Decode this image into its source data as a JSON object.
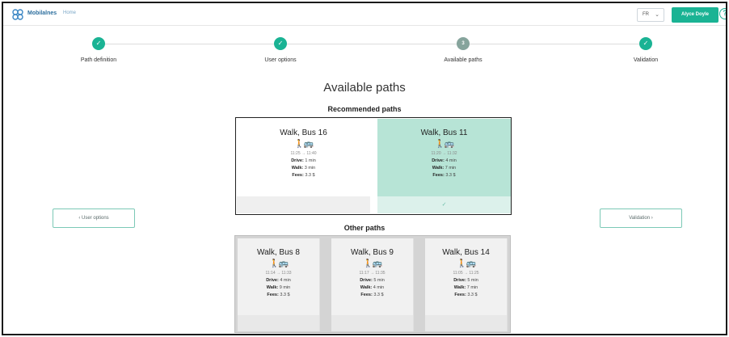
{
  "header": {
    "brand": "Mobilalnes",
    "brand_sub": "Home",
    "language": "FR",
    "user_name": "Alyce Doyle",
    "help": "?"
  },
  "stepper": {
    "steps": [
      {
        "label": "Path definition",
        "marker": "✓"
      },
      {
        "label": "User options",
        "marker": "✓"
      },
      {
        "label": "Available paths",
        "marker": "3"
      },
      {
        "label": "Validation",
        "marker": "✓"
      }
    ]
  },
  "page_title": "Available paths",
  "recommended": {
    "title": "Recommended paths",
    "cards": [
      {
        "title": "Walk, Bus 16",
        "time": "11:25 → 11:40",
        "drive_label": "Drive:",
        "drive": "1 min",
        "walk_label": "Walk:",
        "walk": "3 min",
        "fees_label": "Fees:",
        "fees": "3.3 $"
      },
      {
        "title": "Walk, Bus 11",
        "time": "11:20 → 11:32",
        "drive_label": "Drive:",
        "drive": "4 min",
        "walk_label": "Walk:",
        "walk": "7 min",
        "fees_label": "Fees:",
        "fees": "3.3 $",
        "selected_mark": "✓"
      }
    ]
  },
  "other": {
    "title": "Other paths",
    "cards": [
      {
        "title": "Walk, Bus 8",
        "time": "11:14 → 11:33",
        "drive_label": "Drive:",
        "drive": "4 min",
        "walk_label": "Walk:",
        "walk": "9 min",
        "fees_label": "Fees:",
        "fees": "3.3 $"
      },
      {
        "title": "Walk, Bus 9",
        "time": "11:17 → 11:35",
        "drive_label": "Drive:",
        "drive": "5 min",
        "walk_label": "Walk:",
        "walk": "4 min",
        "fees_label": "Fees:",
        "fees": "3.3 $"
      },
      {
        "title": "Walk, Bus 14",
        "time": "11:05 → 11:25",
        "drive_label": "Drive:",
        "drive": "5 min",
        "walk_label": "Walk:",
        "walk": "7 min",
        "fees_label": "Fees:",
        "fees": "3.3 $"
      }
    ]
  },
  "nav": {
    "back_label": "User options",
    "next_label": "Validation"
  },
  "icons": {
    "walk": "🚶",
    "bus": "🚌"
  },
  "colors": {
    "accent": "#1ab394",
    "selected_card": "#b7e4d6"
  }
}
